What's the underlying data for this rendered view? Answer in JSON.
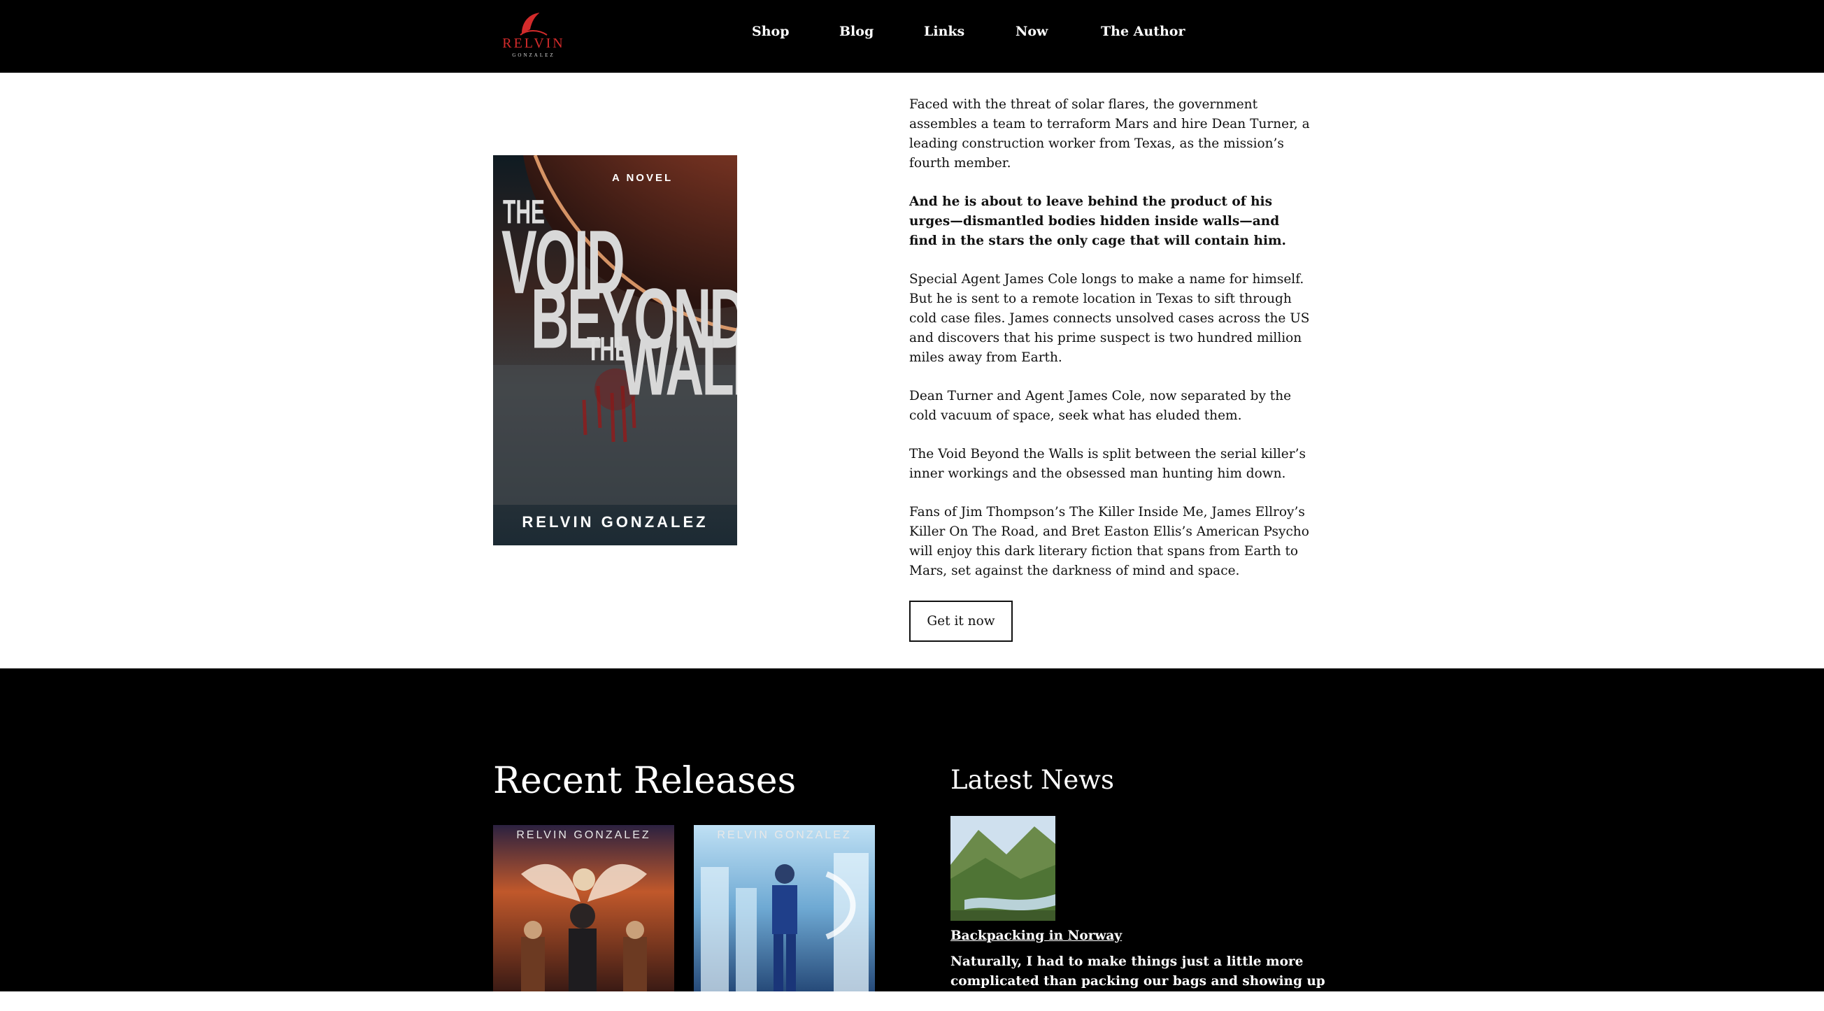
{
  "header": {
    "logo": {
      "name": "RELVIN",
      "sub": "GONZALEZ"
    },
    "nav": [
      "Shop",
      "Blog",
      "Links",
      "Now",
      "The Author"
    ]
  },
  "book": {
    "cover": {
      "tagline": "A NOVEL",
      "title_words": [
        "THE",
        "VOID",
        "BEYOND",
        "THE",
        "WALLS"
      ],
      "author": "RELVIN GONZALEZ"
    },
    "paragraphs": [
      "Faced with the threat of solar flares, the government assembles a team to terraform Mars and hire Dean Turner, a leading construction worker from Texas, as the mission’s fourth member.",
      "And he is about to leave behind the product of his urges—dismantled bodies hidden inside walls—and find in the stars the only cage that will contain him.",
      "Special Agent James Cole longs to make a name for himself. But he is sent to a remote location in Texas to sift through cold case files. James connects unsolved cases across the US and discovers that his prime suspect is two hundred million miles away from Earth.",
      "Dean Turner and Agent James Cole, now separated by the cold vacuum of space, seek what has eluded them.",
      "The Void Beyond the Walls is split between the serial killer’s inner workings and the obsessed man hunting him down.",
      "Fans of Jim Thompson’s The Killer Inside Me, James Ellroy’s Killer On The Road, and Bret Easton Ellis’s American Psycho will enjoy this dark literary fiction that spans from Earth to Mars, set against the darkness of mind and space."
    ],
    "cta": "Get it now"
  },
  "recent": {
    "heading": "Recent Releases",
    "books": [
      {
        "author": "RELVIN GONZALEZ"
      },
      {
        "author": "RELVIN GONZALEZ"
      }
    ]
  },
  "news": {
    "heading": "Latest News",
    "post": {
      "title": "Backpacking in Norway",
      "excerpt": "Naturally, I had to make things just a little more complicated than packing our bags and showing up at the airport. A week"
    }
  }
}
